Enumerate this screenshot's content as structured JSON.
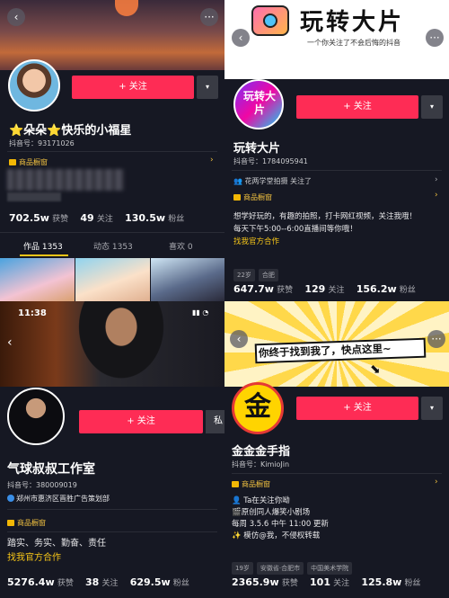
{
  "p1": {
    "follow": "+ 关注",
    "name": "⭐朵朵⭐快乐的小福星",
    "id": "抖音号：93171026",
    "shop": "商品橱窗",
    "stats": {
      "likes": "702.5w",
      "likes_l": "获赞",
      "following": "49",
      "following_l": "关注",
      "fans": "130.5w",
      "fans_l": "粉丝"
    },
    "tabs": [
      "作品 1353",
      "动态 1353",
      "喜欢 0"
    ]
  },
  "p2": {
    "banner": "玩转大片",
    "banner_sub": "一个你关注了不会后悔的抖音",
    "avatar": "玩转大片",
    "follow": "+ 关注",
    "name": "玩转大片",
    "id": "抖音号：1784095941",
    "followed_by": "花两学堂拍摄 关注了",
    "shop": "商品橱窗",
    "bio1": "想学好玩的，有趣的拍照，打卡网红视频，关注我哦！",
    "bio2": "每天下午5:00--6:00直播间等你哦！",
    "bio3": "找我官方合作",
    "tags": [
      "22岁",
      "合肥"
    ],
    "stats": {
      "likes": "647.7w",
      "likes_l": "获赞",
      "following": "129",
      "following_l": "关注",
      "fans": "156.2w",
      "fans_l": "粉丝"
    }
  },
  "p3": {
    "time": "11:38",
    "follow": "+ 关注",
    "cut": "私",
    "name": "气球叔叔工作室",
    "id": "抖音号：380009019",
    "verify": "郑州市惠济区晋胜广告策划部",
    "shop": "商品橱窗",
    "bio1": "踏实、务实、勤奋、责任",
    "bio2": "找我官方合作",
    "stats": {
      "likes": "5276.4w",
      "likes_l": "获赞",
      "following": "38",
      "following_l": "关注",
      "fans": "629.5w",
      "fans_l": "粉丝"
    }
  },
  "p4": {
    "banner": "你终于找到我了，快点这里~",
    "avatar": "金",
    "follow": "+ 关注",
    "name": "金金金手指",
    "id": "抖音号：KimioJin",
    "shop": "商品橱窗",
    "bio1": "👤 Ta在关注你呦",
    "bio2": "🎬原创同人爆笑小剧场",
    "bio3": "每周 3.5.6 中午 11:00 更新",
    "bio4": "✨ 模仿@我，不侵权转载",
    "tags": [
      "19岁",
      "安徽省·合肥市",
      "中国美术学院"
    ],
    "stats": {
      "likes": "2365.9w",
      "likes_l": "获赞",
      "following": "101",
      "following_l": "关注",
      "fans": "125.8w",
      "fans_l": "粉丝"
    }
  }
}
